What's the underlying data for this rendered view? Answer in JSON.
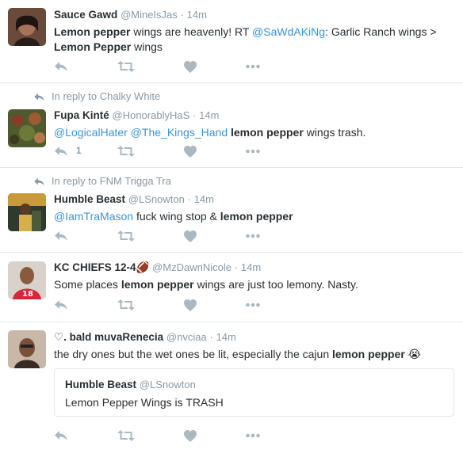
{
  "tweets": [
    {
      "name": "Sauce Gawd",
      "handle": "@MineIsJas",
      "dot": "·",
      "time": "14m",
      "text": {
        "a": "Lemon pepper",
        "b": " wings are heavenly!  RT ",
        "c": "@SaWdAKiNg",
        "d": ": Garlic Ranch wings > ",
        "e": "Lemon Pepper",
        "f": " wings"
      }
    },
    {
      "reply_to": "In reply to Chalky White",
      "name": "Fupa Kinté",
      "handle": "@HonorablyHaS",
      "dot": "·",
      "time": "14m",
      "reply_count": "1",
      "text": {
        "m1": "@LogicalHater",
        "sp": " ",
        "m2": "@The_Kings_Hand",
        "sp2": " ",
        "hl": "lemon pepper",
        "rest": " wings trash."
      }
    },
    {
      "reply_to": "In reply to FNM Trigga Tra",
      "name": "Humble Beast",
      "handle": "@LSnowton",
      "dot": "·",
      "time": "14m",
      "text": {
        "m1": "@IamTraMason",
        "mid": " fuck wing stop & ",
        "hl": "lemon pepper"
      }
    },
    {
      "name": "KC CHIEFS 12-4",
      "emoji": "🏈",
      "handle": "@MzDawnNicole",
      "dot": "·",
      "time": "14m",
      "text": {
        "pre": "Some places ",
        "hl": "lemon pepper",
        "rest": " wings are just too lemony. Nasty."
      }
    },
    {
      "name": "♡. bald muvaRenecia",
      "handle": "@nvciaa",
      "dot": "·",
      "time": "14m",
      "text": {
        "pre": "the dry ones but the wet ones be lit, especially the cajun ",
        "hl": "lemon pepper",
        "emoji": " 😭"
      },
      "quote": {
        "name": "Humble Beast",
        "handle": "@LSnowton",
        "text": "Lemon Pepper Wings is TRASH"
      }
    }
  ],
  "icons": {
    "reply": "reply-icon",
    "retweet": "retweet-icon",
    "like": "heart-icon",
    "more": "more-icon"
  },
  "colors": {
    "icon": "#aab8c2",
    "mention": "#3b94d9",
    "muted": "#8899a6"
  }
}
